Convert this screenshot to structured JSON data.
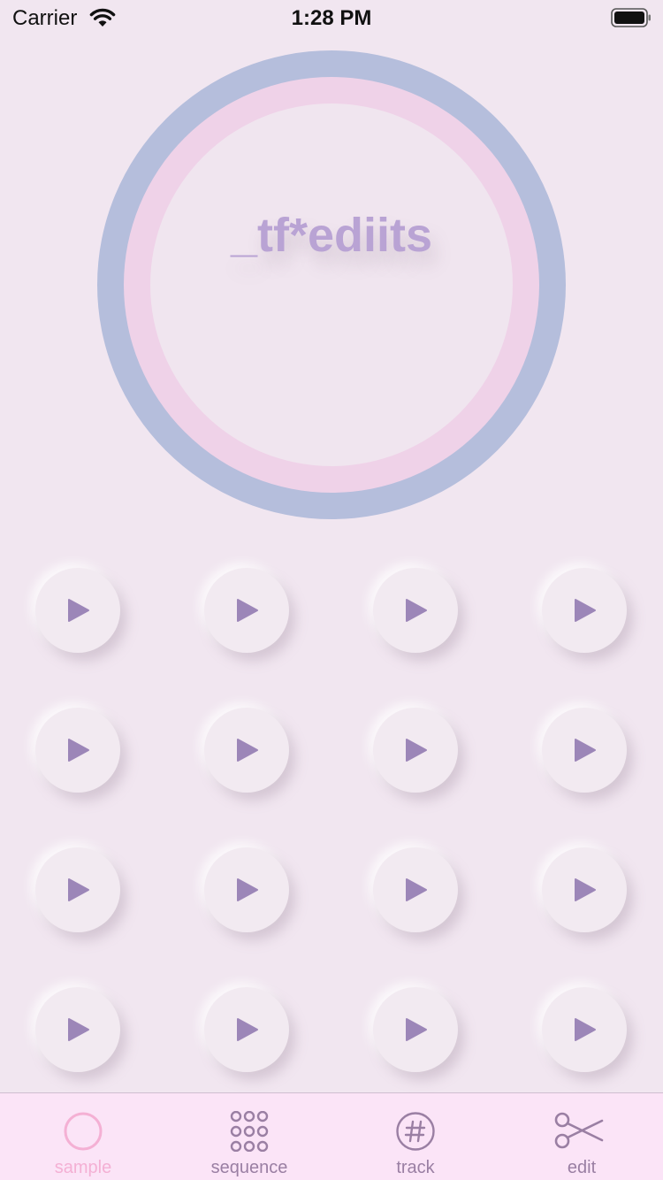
{
  "status_bar": {
    "carrier": "Carrier",
    "time": "1:28 PM"
  },
  "logo": {
    "text": "_tf*ediits"
  },
  "pads": [
    {
      "icon": "play-icon"
    },
    {
      "icon": "play-icon"
    },
    {
      "icon": "play-icon"
    },
    {
      "icon": "play-icon"
    },
    {
      "icon": "play-icon"
    },
    {
      "icon": "play-icon"
    },
    {
      "icon": "play-icon"
    },
    {
      "icon": "play-icon"
    },
    {
      "icon": "play-icon"
    },
    {
      "icon": "play-icon"
    },
    {
      "icon": "play-icon"
    },
    {
      "icon": "play-icon"
    },
    {
      "icon": "play-icon"
    },
    {
      "icon": "play-icon"
    },
    {
      "icon": "play-icon"
    },
    {
      "icon": "play-icon"
    }
  ],
  "tabs": [
    {
      "label": "sample",
      "icon": "circle-icon",
      "selected": true
    },
    {
      "label": "sequence",
      "icon": "grid-dots-icon",
      "selected": false
    },
    {
      "label": "track",
      "icon": "hash-circle-icon",
      "selected": false
    },
    {
      "label": "edit",
      "icon": "scissors-icon",
      "selected": false
    }
  ],
  "colors": {
    "background": "#f1e6f0",
    "ring_outer": "#b5bedc",
    "ring_middle": "#efd2e8",
    "logo": "#b9a3d4",
    "play": "#9c86b8",
    "tab_selected": "#f4b0d4",
    "tab_unselected": "#9a7fa3",
    "tab_bar": "#fbe4f7"
  }
}
